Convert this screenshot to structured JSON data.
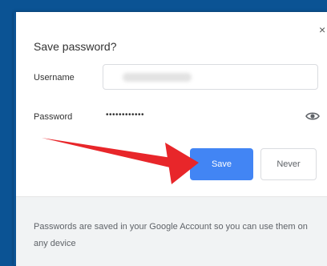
{
  "dialog": {
    "title": "Save password?",
    "close_glyph": "×",
    "username_label": "Username",
    "password_label": "Password",
    "password_value": "••••••••••••",
    "save_label": "Save",
    "never_label": "Never",
    "footer_text": "Passwords are saved in your Google Account so you can use them on any device"
  },
  "colors": {
    "background": "#0b5394",
    "save_button": "#4285f4",
    "arrow": "#e8262a"
  },
  "icons": {
    "close": "close-icon",
    "eye": "eye-icon"
  }
}
